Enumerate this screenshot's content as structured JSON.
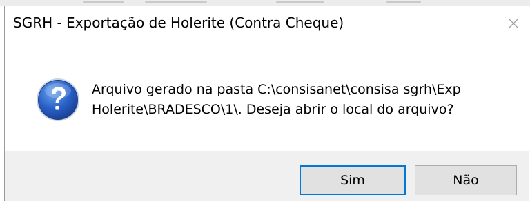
{
  "dialog": {
    "title": "SGRH - Exportação de Holerite (Contra Cheque)",
    "icon": "question-icon",
    "message_lines": [
      "Arquivo gerado na pasta C:\\consisanet\\consisa sgrh\\Exp",
      "Holerite\\BRADESCO\\1\\. Deseja abrir o local do arquivo?"
    ],
    "buttons": {
      "yes_label": "Sim",
      "no_label": "Não"
    }
  },
  "colors": {
    "accent": "#0078d7",
    "footer_bg": "#f0f0f0",
    "button_bg": "#e1e1e1"
  }
}
